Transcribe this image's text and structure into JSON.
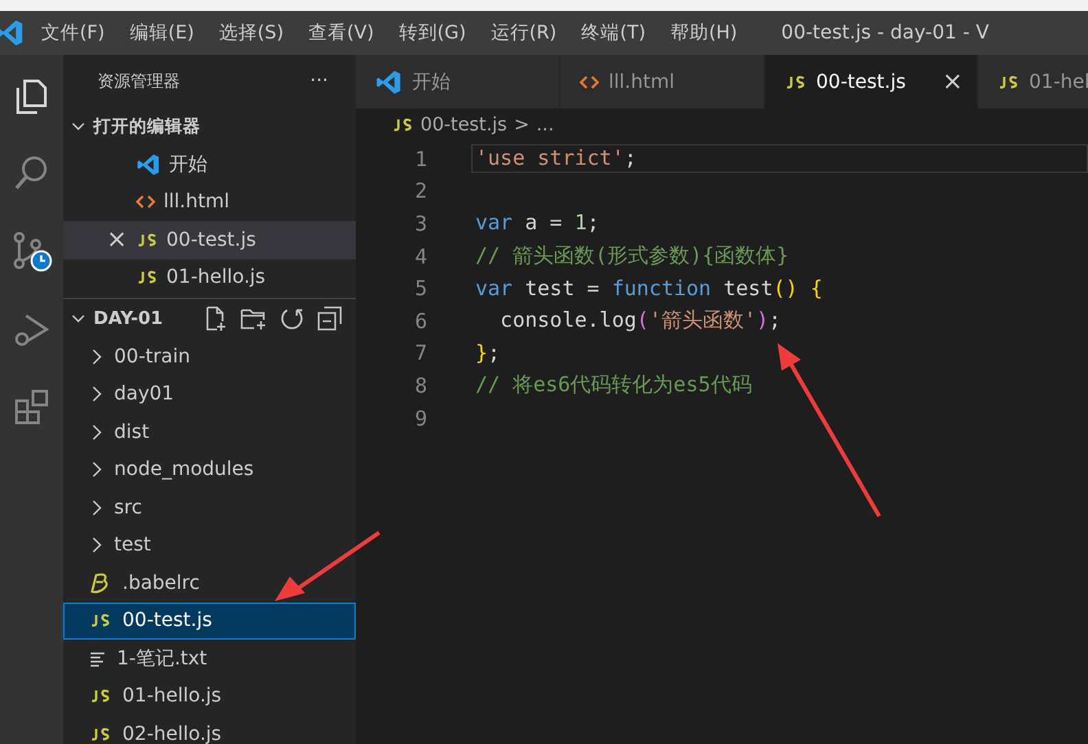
{
  "menu": [
    "文件(F)",
    "编辑(E)",
    "选择(S)",
    "查看(V)",
    "转到(G)",
    "运行(R)",
    "终端(T)",
    "帮助(H)"
  ],
  "window": {
    "title": "00-test.js - day-01 - V"
  },
  "sidebar": {
    "title": "资源管理器",
    "more": "···",
    "open_editors": {
      "title": "打开的编辑器",
      "expanded": true,
      "items": [
        {
          "label": "开始",
          "kind": "welcome",
          "selected": false
        },
        {
          "label": "lll.html",
          "kind": "html",
          "selected": false
        },
        {
          "label": "00-test.js",
          "kind": "js",
          "selected": true,
          "close": "×"
        },
        {
          "label": "01-hello.js",
          "kind": "js",
          "selected": false
        }
      ]
    },
    "folder": {
      "title": "DAY-01",
      "expanded": true,
      "items": [
        {
          "label": "00-train",
          "kind": "folder",
          "selected": false
        },
        {
          "label": "day01",
          "kind": "folder",
          "selected": false
        },
        {
          "label": "dist",
          "kind": "folder",
          "selected": false
        },
        {
          "label": "node_modules",
          "kind": "folder",
          "selected": false
        },
        {
          "label": "src",
          "kind": "folder",
          "selected": false
        },
        {
          "label": "test",
          "kind": "folder",
          "selected": false
        },
        {
          "label": ".babelrc",
          "kind": "babel",
          "selected": false
        },
        {
          "label": "00-test.js",
          "kind": "js",
          "selected": true
        },
        {
          "label": "1-笔记.txt",
          "kind": "txt",
          "selected": false
        },
        {
          "label": "01-hello.js",
          "kind": "js",
          "selected": false
        },
        {
          "label": "02-hello.js",
          "kind": "js",
          "selected": false
        }
      ]
    }
  },
  "tabs": [
    {
      "label": "开始",
      "kind": "welcome",
      "selected": false
    },
    {
      "label": "lll.html",
      "kind": "html",
      "selected": false
    },
    {
      "label": "00-test.js",
      "kind": "js",
      "selected": true,
      "close": "×"
    },
    {
      "label": "01-hel",
      "kind": "js",
      "selected": false
    }
  ],
  "breadcrumb": {
    "file": "00-test.js",
    "sep": ">",
    "rest": "..."
  },
  "code": [
    {
      "number": "1",
      "selected": true,
      "tokens": [
        {
          "kind": "string",
          "text": "'use strict'"
        },
        {
          "kind": "plain",
          "text": ";"
        }
      ]
    },
    {
      "number": "2",
      "selected": false
    },
    {
      "number": "3",
      "selected": false,
      "tokens": [
        {
          "kind": "keyword",
          "text": "var"
        },
        {
          "kind": "plain",
          "text": " a = "
        },
        {
          "kind": "number",
          "text": "1"
        },
        {
          "kind": "plain",
          "text": ";"
        }
      ]
    },
    {
      "number": "4",
      "selected": false,
      "tokens": [
        {
          "kind": "comment",
          "text": "// 箭头函数(形式参数){函数体}"
        }
      ]
    },
    {
      "number": "5",
      "selected": false,
      "tokens": [
        {
          "kind": "keyword",
          "text": "var"
        },
        {
          "kind": "plain",
          "text": " test = "
        },
        {
          "kind": "keyword",
          "text": "function"
        },
        {
          "kind": "plain",
          "text": " test"
        },
        {
          "kind": "bracket",
          "text": "()"
        },
        {
          "kind": "bracket",
          "text": " {"
        }
      ]
    },
    {
      "number": "6",
      "selected": false,
      "tokens": [
        {
          "kind": "plain",
          "text": "  console.log"
        },
        {
          "kind": "paren",
          "text": "("
        },
        {
          "kind": "string",
          "text": "'箭头函数'"
        },
        {
          "kind": "paren",
          "text": ")"
        },
        {
          "kind": "plain",
          "text": ";"
        }
      ]
    },
    {
      "number": "7",
      "selected": false,
      "tokens": [
        {
          "kind": "bracket",
          "text": "}"
        },
        {
          "kind": "plain",
          "text": ";"
        }
      ]
    },
    {
      "number": "8",
      "selected": false,
      "tokens": [
        {
          "kind": "comment",
          "text": "// 将es6代码转化为es5代码"
        }
      ]
    },
    {
      "number": "9",
      "selected": false
    }
  ]
}
